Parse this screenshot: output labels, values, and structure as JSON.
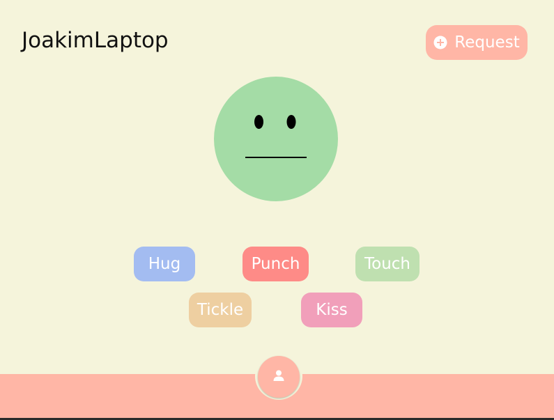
{
  "header": {
    "device_name": "JoakimLaptop",
    "request_label": "Request",
    "request_icon": "add-circle-icon"
  },
  "face": {
    "expression": "neutral",
    "color": "#a4dca6"
  },
  "actions": [
    {
      "label": "Hug",
      "color": "#a3bcf1"
    },
    {
      "label": "Punch",
      "color": "#fe8b87"
    },
    {
      "label": "Touch",
      "color": "#bfe0b0"
    },
    {
      "label": "Tickle",
      "color": "#eecfa1"
    },
    {
      "label": "Kiss",
      "color": "#f19fba"
    }
  ],
  "bottom_nav": {
    "fab_icon": "person-icon"
  },
  "colors": {
    "background": "#f5f4db",
    "accent": "#ffb6a6"
  }
}
